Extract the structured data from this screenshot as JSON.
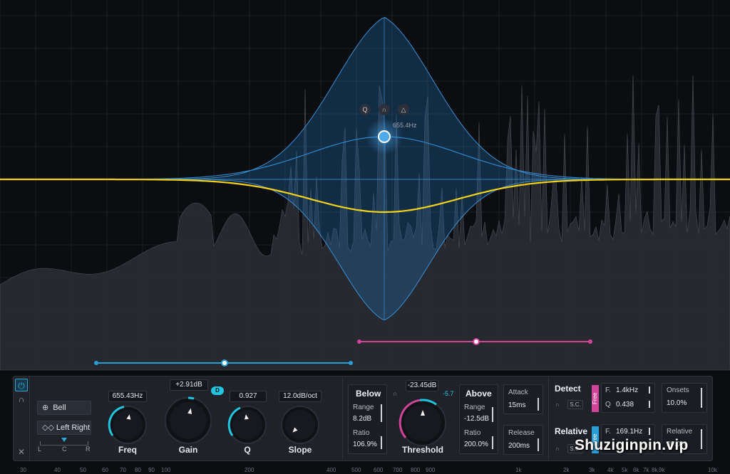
{
  "colors": {
    "band_blue": "#2a9fd6",
    "eq_curve": "#f2d21a",
    "dynamic_pink": "#d0449a",
    "accent_cyan": "#22c5e0",
    "spectrum": "#3a3d44"
  },
  "node": {
    "freq_tooltip": "655.4Hz",
    "icons": [
      "q-icon",
      "headphones-icon",
      "bell-shape-icon"
    ],
    "icon_glyphs": [
      "Q",
      "∩",
      "△"
    ]
  },
  "band": {
    "shape": "Bell",
    "stereo": "Left Right",
    "pan_labels": [
      "L",
      "C",
      "R"
    ],
    "freq": {
      "value": "655.43Hz",
      "label": "Freq"
    },
    "gain": {
      "value": "+2.91dB",
      "label": "Gain",
      "dyn_badge": "D"
    },
    "q": {
      "value": "0.927",
      "label": "Q"
    },
    "slope": {
      "value": "12.0dB/oct",
      "label": "Slope"
    }
  },
  "dynamics": {
    "below": {
      "title": "Below",
      "range_label": "Range",
      "range_value": "8.2dB",
      "ratio_label": "Ratio",
      "ratio_value": "106.9%"
    },
    "threshold": {
      "value": "-23.45dB",
      "label": "Threshold",
      "side_value": "-5.7"
    },
    "above": {
      "title": "Above",
      "range_label": "Range",
      "range_value": "-12.5dB",
      "ratio_label": "Ratio",
      "ratio_value": "200.0%"
    },
    "attack": {
      "label": "Attack",
      "value": "15ms"
    },
    "release": {
      "label": "Release",
      "value": "200ms"
    }
  },
  "detect": {
    "title": "Detect",
    "sc_label": "S.C.",
    "mode_tag": "Free",
    "f_label": "F.",
    "f_value": "1.4kHz",
    "q_label": "Q",
    "q_value": "0.438",
    "onsets_label": "Onsets",
    "onsets_value": "10.0%"
  },
  "relative": {
    "title": "Relative",
    "sc_label": "S.C.",
    "mode_tag": "Free",
    "f_label": "F.",
    "f_value": "169.1Hz",
    "relative_label": "Relative",
    "relative_value": "30.0%"
  },
  "freq_axis": [
    "30",
    "40",
    "50",
    "60",
    "70",
    "80",
    "90",
    "100",
    "200",
    "400",
    "500",
    "600",
    "700",
    "800",
    "900",
    "1k",
    "2k",
    "3k",
    "4k",
    "5k",
    "6k",
    "7k",
    "8k",
    "9k",
    "10k"
  ],
  "watermark": "Shuziginpin.vip"
}
